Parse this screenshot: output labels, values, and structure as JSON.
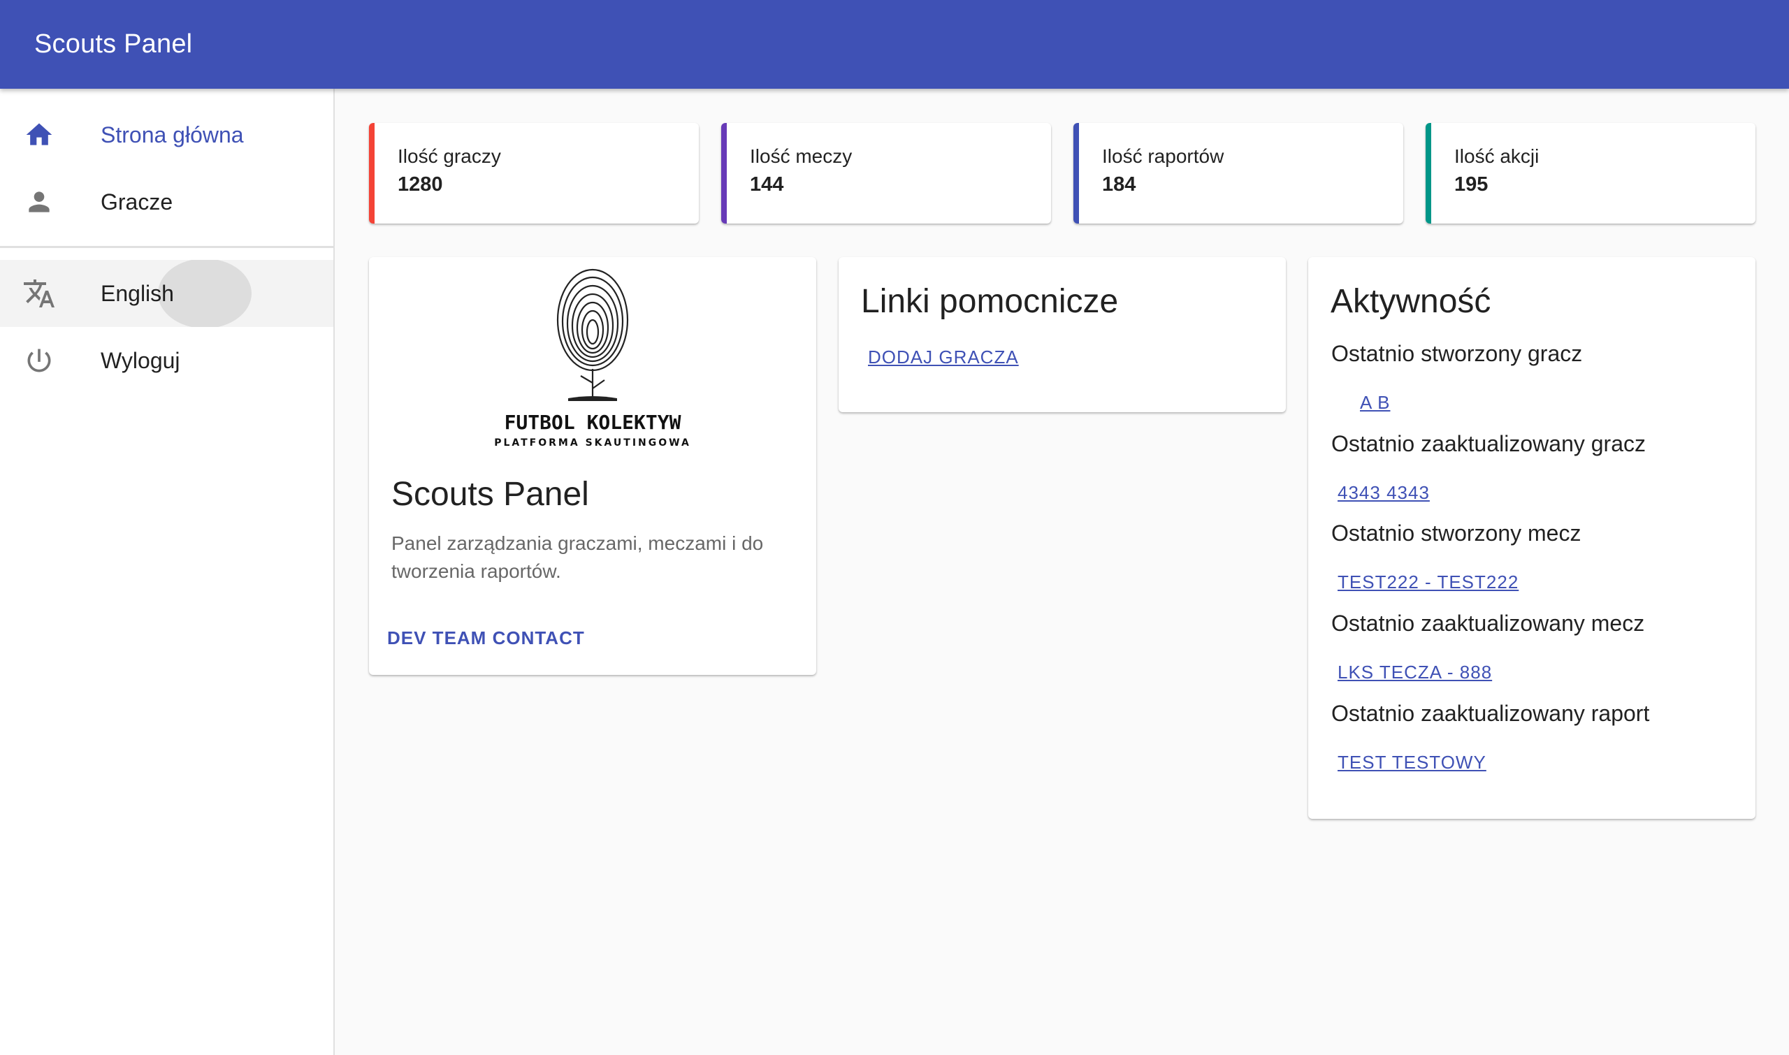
{
  "app": {
    "title": "Scouts Panel"
  },
  "colors": {
    "primary": "#3f51b5",
    "stat_red": "#f44336",
    "stat_purple": "#673ab7",
    "stat_indigo": "#3f51b5",
    "stat_teal": "#009688"
  },
  "sidebar": {
    "items": [
      {
        "label": "Strona główna",
        "icon": "home-icon"
      },
      {
        "label": "Gracze",
        "icon": "person-icon"
      },
      {
        "label": "English",
        "icon": "translate-icon"
      },
      {
        "label": "Wyloguj",
        "icon": "power-icon"
      }
    ]
  },
  "stats": [
    {
      "label": "Ilość graczy",
      "value": "1280"
    },
    {
      "label": "Ilość meczy",
      "value": "144"
    },
    {
      "label": "Ilość raportów",
      "value": "184"
    },
    {
      "label": "Ilość akcji",
      "value": "195"
    }
  ],
  "info_card": {
    "logo_text": "FUTBOL KOLEKTYW",
    "logo_subtext": "PLATFORMA SKAUTINGOWA",
    "title": "Scouts Panel",
    "description": "Panel zarządzania graczami, meczami i do tworzenia raportów.",
    "button": "DEV TEAM CONTACT"
  },
  "links_card": {
    "title": "Linki pomocnicze",
    "links": [
      "DODAJ GRACZA"
    ]
  },
  "activity_card": {
    "title": "Aktywność",
    "entries": [
      {
        "label": "Ostatnio stworzony gracz",
        "link": "A B"
      },
      {
        "label": "Ostatnio zaaktualizowany gracz",
        "link": "4343 4343"
      },
      {
        "label": "Ostatnio stworzony mecz",
        "link": "TEST222 - TEST222"
      },
      {
        "label": "Ostatnio zaaktualizowany mecz",
        "link": "LKS TECZA - 888"
      },
      {
        "label": "Ostatnio zaaktualizowany raport",
        "link": "TEST TESTOWY"
      }
    ]
  }
}
